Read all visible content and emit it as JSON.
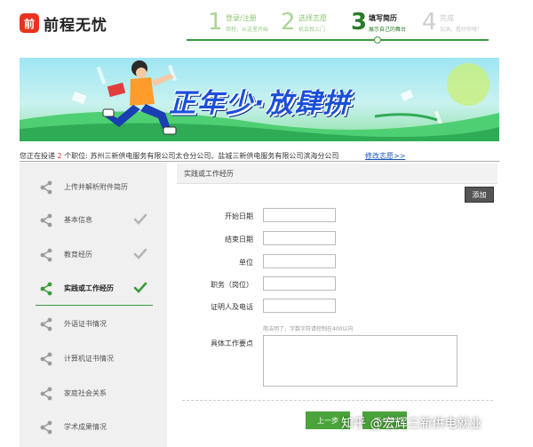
{
  "brand": {
    "logo_glyph": "前",
    "name": "前程无忧"
  },
  "steps": [
    {
      "num": "1",
      "title": "登录/注册",
      "sub": "简程，从这里开始"
    },
    {
      "num": "2",
      "title": "选择志愿",
      "sub": "机会就上门"
    },
    {
      "num": "3",
      "title": "填写简历",
      "sub": "展示自己的舞台"
    },
    {
      "num": "4",
      "title": "完成",
      "sub": "加油，看好你哦！"
    }
  ],
  "banner": {
    "title": "正年少·放肆拼"
  },
  "apply": {
    "prefix": "您正在投递",
    "count": "2",
    "suffix": "个职位:",
    "companies": "苏州三新供电服务有限公司太仓分公司、盐城三新供电服务有限公司滨海分公司",
    "modify_link": "修改志愿>>"
  },
  "sidebar": {
    "items": [
      {
        "label": "上传并解析附件简历",
        "checked": false
      },
      {
        "label": "基本信息",
        "checked": true
      },
      {
        "label": "教育经历",
        "checked": true
      },
      {
        "label": "实践或工作经历",
        "checked": true,
        "active": true
      },
      {
        "label": "外语证书情况",
        "checked": false
      },
      {
        "label": "计算机证书情况",
        "checked": false
      },
      {
        "label": "家庭社会关系",
        "checked": false
      },
      {
        "label": "学术成果情况",
        "checked": false
      }
    ]
  },
  "form": {
    "section_title": "实践或工作经历",
    "add_button": "添加",
    "fields": {
      "start_date": {
        "label": "开始日期",
        "value": ""
      },
      "end_date": {
        "label": "结束日期",
        "value": ""
      },
      "unit": {
        "label": "单位",
        "value": ""
      },
      "position": {
        "label": "职务（岗位）",
        "value": ""
      },
      "witness": {
        "label": "证明人及电话",
        "value": ""
      },
      "detail": {
        "label": "具体工作要点",
        "value": "",
        "hint": "简洁明了，字数字符请控制在400以内"
      }
    },
    "prev_button": "上一步",
    "next_button": "下一步"
  },
  "watermark": "知乎 @宏辉三新供电就业",
  "colors": {
    "accent": "#4aa43a",
    "brand": "#e8331f",
    "link": "#1c55b8"
  }
}
